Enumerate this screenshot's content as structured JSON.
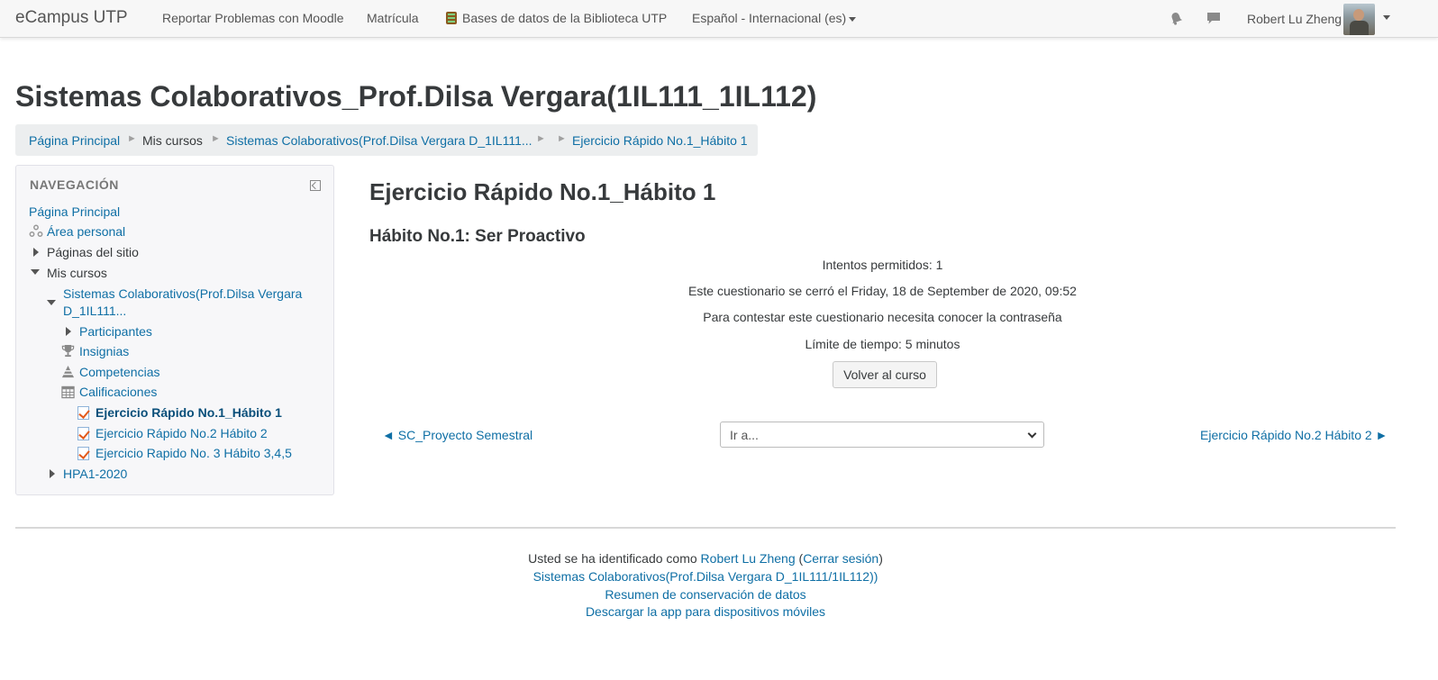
{
  "navbar": {
    "brand": "eCampus UTP",
    "links": [
      "Reportar Problemas con Moodle",
      "Matrícula",
      "Bases de datos de la Biblioteca UTP",
      "Español - Internacional (es)"
    ],
    "user_name": "Robert Lu Zheng"
  },
  "page": {
    "title": "Sistemas Colaborativos_Prof.Dilsa Vergara(1IL111_1IL112)"
  },
  "breadcrumb": [
    "Página Principal",
    "Mis cursos",
    "Sistemas Colaborativos(Prof.Dilsa Vergara D_1IL111...",
    "Ejercicio Rápido No.1_Hábito 1"
  ],
  "nav_block": {
    "title": "NAVEGACIÓN",
    "items": {
      "home": "Página Principal",
      "dashboard": "Área personal",
      "site_pages": "Páginas del sitio",
      "my_courses": "Mis cursos",
      "course": "Sistemas Colaborativos(Prof.Dilsa Vergara",
      "course_line2": "D_1IL111...",
      "participants": "Participantes",
      "badges": "Insignias",
      "competencies": "Competencias",
      "grades": "Calificaciones",
      "quiz1": "Ejercicio Rápido No.1_Hábito 1",
      "quiz2": "Ejercicio Rápido No.2 Hábito 2",
      "quiz3": "Ejercicio Rapido No. 3 Hábito 3,4,5",
      "hpa": "HPA1-2020"
    }
  },
  "main": {
    "heading": "Ejercicio Rápido No.1_Hábito 1",
    "subheading": "Hábito No.1: Ser Proactivo",
    "info": [
      "Intentos permitidos: 1",
      "Este cuestionario se cerró el Friday, 18 de September de 2020, 09:52",
      "Para contestar este cuestionario necesita conocer la contraseña",
      "Límite de tiempo: 5 minutos"
    ],
    "back_button": "Volver al curso",
    "prev_link": "◄ SC_Proyecto Semestral",
    "jump_select": "Ir a...",
    "next_link": "Ejercicio Rápido No.2 Hábito 2 ►"
  },
  "footer": {
    "logged_in_prefix": "Usted se ha identificado como",
    "user_link": "Robert Lu Zheng",
    "paren_open": "(",
    "logout": "Cerrar sesión",
    "paren_close": ")",
    "course_link": "Sistemas Colaborativos(Prof.Dilsa Vergara D_1IL111/1IL112))",
    "data_retention": "Resumen de conservación de datos",
    "mobile_app": "Descargar la app para dispositivos móviles"
  }
}
